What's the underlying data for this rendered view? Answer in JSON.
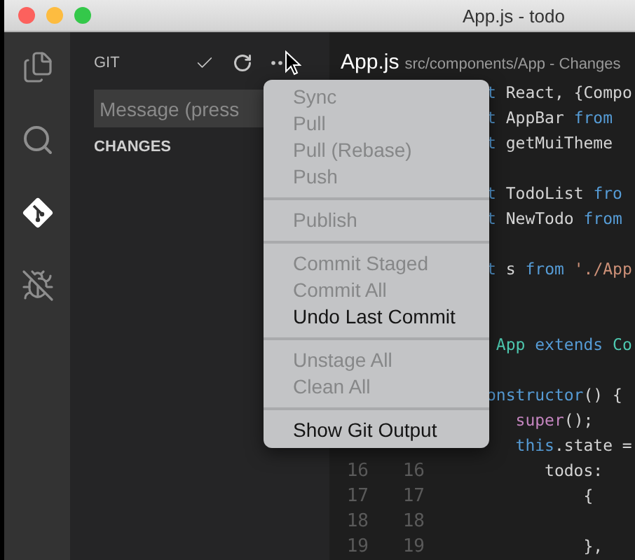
{
  "window": {
    "title": "App.js - todo"
  },
  "activity_bar": [
    {
      "kind": "files",
      "selected": false
    },
    {
      "kind": "search",
      "selected": false
    },
    {
      "kind": "git",
      "selected": true
    },
    {
      "kind": "debug",
      "selected": false
    }
  ],
  "sidebar": {
    "title": "GIT",
    "message": {
      "placeholder": "Message (press"
    },
    "section": "CHANGES"
  },
  "editor": {
    "file": "App.js",
    "path": "src/components/App - Changes",
    "lines": [
      {
        "kind": "code",
        "segments": [
          {
            "kind": "keyword",
            "text": "t"
          },
          {
            "kind": "plain",
            "text": " React, {Compo"
          }
        ]
      },
      {
        "kind": "code",
        "segments": [
          {
            "kind": "keyword",
            "text": "t"
          },
          {
            "kind": "plain",
            "text": " AppBar "
          },
          {
            "kind": "keyword",
            "text": "from"
          }
        ]
      },
      {
        "kind": "code",
        "segments": [
          {
            "kind": "keyword",
            "text": "t"
          },
          {
            "kind": "plain",
            "text": " getMuiTheme"
          }
        ]
      },
      {
        "kind": "blank"
      },
      {
        "kind": "code",
        "segments": [
          {
            "kind": "keyword",
            "text": "t"
          },
          {
            "kind": "plain",
            "text": " TodoList "
          },
          {
            "kind": "keyword",
            "text": "fro"
          }
        ]
      },
      {
        "kind": "code",
        "segments": [
          {
            "kind": "keyword",
            "text": "t"
          },
          {
            "kind": "plain",
            "text": " NewTodo "
          },
          {
            "kind": "keyword",
            "text": "from"
          }
        ]
      },
      {
        "kind": "blank"
      },
      {
        "kind": "code",
        "segments": [
          {
            "kind": "keyword",
            "text": "t"
          },
          {
            "kind": "plain",
            "text": " s "
          },
          {
            "kind": "keyword",
            "text": "from"
          },
          {
            "kind": "string",
            "text": " './App"
          }
        ]
      },
      {
        "kind": "blank"
      },
      {
        "kind": "blank"
      },
      {
        "kind": "code",
        "segments": [
          {
            "kind": "type",
            "text": " App"
          },
          {
            "kind": "keyword",
            "text": " extends"
          },
          {
            "kind": "type",
            "text": " Co"
          }
        ]
      },
      {
        "kind": "blank"
      },
      {
        "kind": "code",
        "segments": [
          {
            "kind": "keyword",
            "text": "onstructor"
          },
          {
            "kind": "plain",
            "text": "() {"
          }
        ]
      },
      {
        "kind": "code",
        "segments": [
          {
            "kind": "call",
            "text": "   super"
          },
          {
            "kind": "plain",
            "text": "();"
          }
        ]
      },
      {
        "kind": "code",
        "segments": [
          {
            "kind": "keyword",
            "text": "   this"
          },
          {
            "kind": "plain",
            "text": ".state ="
          }
        ]
      },
      {
        "kind": "code",
        "numbers": [
          "16",
          "16"
        ],
        "segments": [
          {
            "kind": "plain",
            "text": "      todos:"
          }
        ]
      },
      {
        "kind": "code",
        "numbers": [
          "17",
          "17"
        ],
        "segments": [
          {
            "kind": "plain",
            "text": "          {"
          }
        ]
      },
      {
        "kind": "blank",
        "numbers": [
          "18",
          "18"
        ]
      },
      {
        "kind": "code",
        "numbers": [
          "19",
          "19"
        ],
        "segments": [
          {
            "kind": "plain",
            "text": "          },"
          }
        ]
      }
    ]
  },
  "menu": [
    {
      "kind": "item",
      "label": "Sync",
      "disabled": true
    },
    {
      "kind": "item",
      "label": "Pull",
      "disabled": true
    },
    {
      "kind": "item",
      "label": "Pull (Rebase)",
      "disabled": true
    },
    {
      "kind": "item",
      "label": "Push",
      "disabled": true
    },
    {
      "kind": "separator"
    },
    {
      "kind": "item",
      "label": "Publish",
      "disabled": true
    },
    {
      "kind": "separator"
    },
    {
      "kind": "item",
      "label": "Commit Staged",
      "disabled": true
    },
    {
      "kind": "item",
      "label": "Commit All",
      "disabled": true
    },
    {
      "kind": "item",
      "label": "Undo Last Commit",
      "disabled": false
    },
    {
      "kind": "separator"
    },
    {
      "kind": "item",
      "label": "Unstage All",
      "disabled": true
    },
    {
      "kind": "item",
      "label": "Clean All",
      "disabled": true
    },
    {
      "kind": "separator"
    },
    {
      "kind": "item",
      "label": "Show Git Output",
      "disabled": false
    }
  ]
}
